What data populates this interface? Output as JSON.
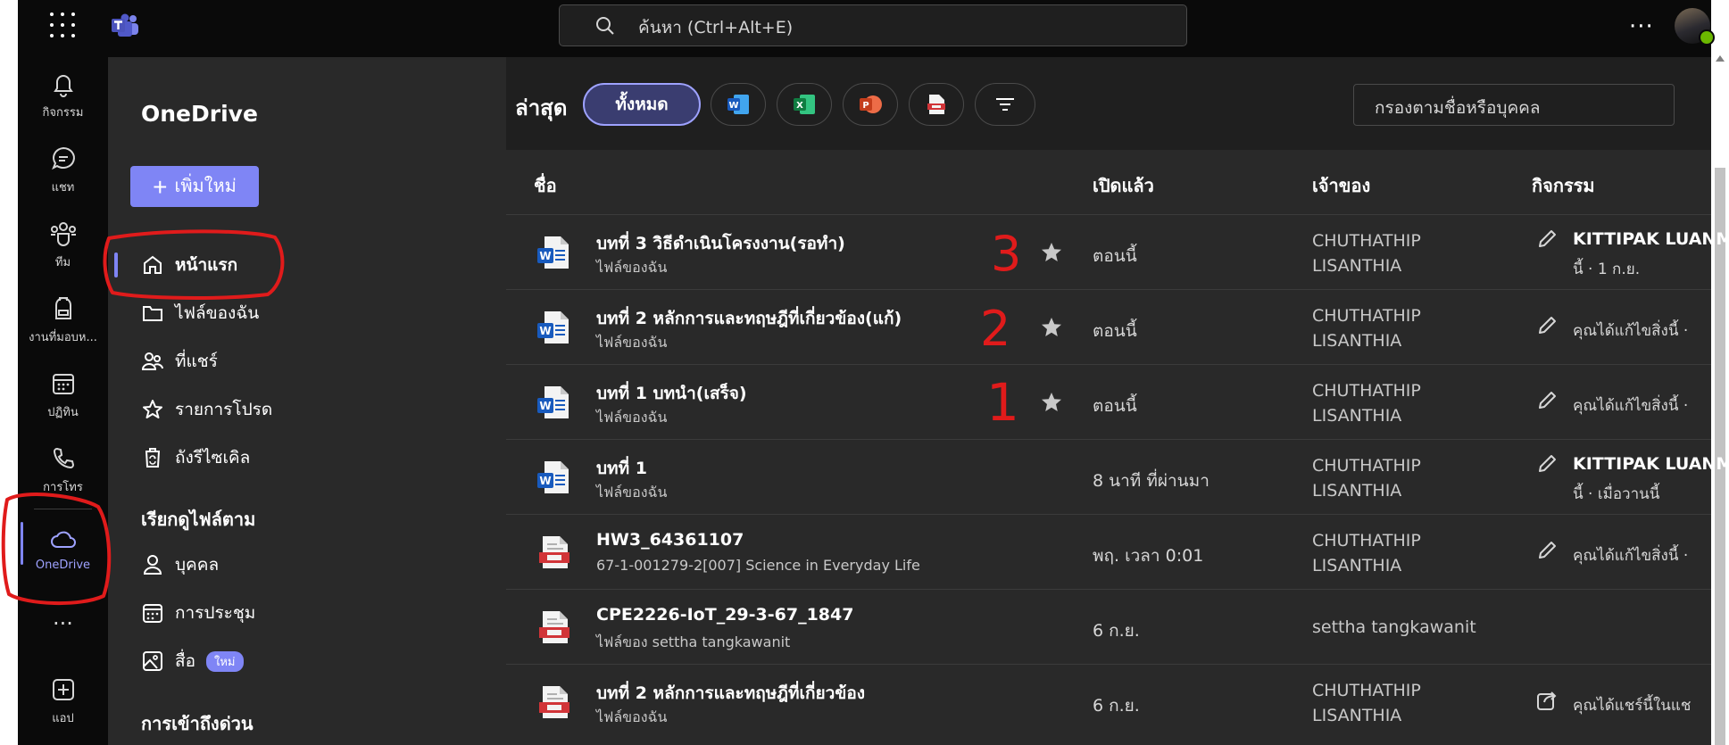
{
  "search": {
    "placeholder": "ค้นหา (Ctrl+Alt+E)"
  },
  "rail": {
    "items": [
      {
        "label": "กิจกรรม"
      },
      {
        "label": "แชท"
      },
      {
        "label": "ทีม"
      },
      {
        "label": "งานที่มอบห..."
      },
      {
        "label": "ปฏิทิน"
      },
      {
        "label": "การโทร"
      },
      {
        "label": "OneDrive"
      },
      {
        "label": "แอป"
      }
    ]
  },
  "nav": {
    "title": "OneDrive",
    "add_new": "เพิ่มใหม่",
    "items": [
      {
        "label": "หน้าแรก"
      },
      {
        "label": "ไฟล์ของฉัน"
      },
      {
        "label": "ที่แชร์"
      },
      {
        "label": "รายการโปรด"
      },
      {
        "label": "ถังรีไซเคิล"
      }
    ],
    "browse_title": "เรียกดูไฟล์ตาม",
    "browse_items": [
      {
        "label": "บุคคล"
      },
      {
        "label": "การประชุม"
      },
      {
        "label": "สื่อ",
        "badge": "ใหม่"
      }
    ],
    "quick_access_title": "การเข้าถึงด่วน"
  },
  "filters": {
    "recent_label": "ล่าสุด",
    "all_label": "ทั้งหมด",
    "filter_placeholder": "กรองตามชื่อหรือบุคคล"
  },
  "table": {
    "headers": {
      "name": "ชื่อ",
      "opened": "เปิดแล้ว",
      "owner": "เจ้าของ",
      "activity": "กิจกรรม"
    },
    "rows": [
      {
        "name": "บทที่ 3 วิธีดำเนินโครงงาน(รอทำ)",
        "location": "ไฟล์ของฉัน",
        "opened": "ตอนนี้",
        "owner_line1": "CHUTHATHIP",
        "owner_line2": "LISANTHIA",
        "activity_name": "KITTIPAK LUANM",
        "activity_sub": "นี้ · 1 ก.ย.",
        "type": "word",
        "favorite": true
      },
      {
        "name": "บทที่ 2 หลักการและทฤษฎีที่เกี่ยวข้อง(แก้)",
        "location": "ไฟล์ของฉัน",
        "opened": "ตอนนี้",
        "owner_line1": "CHUTHATHIP",
        "owner_line2": "LISANTHIA",
        "activity_text": "คุณได้แก้ไขสิ่งนี้ ·",
        "type": "word",
        "favorite": true
      },
      {
        "name": "บทที่ 1 บทนำ(เสร็จ)",
        "location": "ไฟล์ของฉัน",
        "opened": "ตอนนี้",
        "owner_line1": "CHUTHATHIP",
        "owner_line2": "LISANTHIA",
        "activity_text": "คุณได้แก้ไขสิ่งนี้ ·",
        "type": "word",
        "favorite": true
      },
      {
        "name": "บทที่ 1",
        "location": "ไฟล์ของฉัน",
        "opened": "8 นาที ที่ผ่านมา",
        "owner_line1": "CHUTHATHIP",
        "owner_line2": "LISANTHIA",
        "activity_name": "KITTIPAK LUANM",
        "activity_sub": "นี้ · เมื่อวานนี้",
        "type": "word",
        "favorite": false
      },
      {
        "name": "HW3_64361107",
        "location": "67-1-001279-2[007] Science in Everyday Life",
        "opened": "พฤ. เวลา 0:01",
        "owner_line1": "CHUTHATHIP",
        "owner_line2": "LISANTHIA",
        "activity_text": "คุณได้แก้ไขสิ่งนี้ ·",
        "type": "pdf",
        "favorite": false
      },
      {
        "name": "CPE2226-IoT_29-3-67_1847",
        "location": "ไฟล์ของ settha tangkawanit",
        "opened": "6 ก.ย.",
        "owner_single": "settha tangkawanit",
        "type": "pdf",
        "favorite": false
      },
      {
        "name": "บทที่ 2 หลักการและทฤษฎีที่เกี่ยวข้อง",
        "location": "ไฟล์ของฉัน",
        "opened": "6 ก.ย.",
        "owner_line1": "CHUTHATHIP",
        "owner_line2": "LISANTHIA",
        "activity_text": "คุณได้แชร์นี้ในแช",
        "type": "pdf",
        "favorite": false
      }
    ]
  },
  "annotations": {
    "numbers": [
      "3",
      "2",
      "1"
    ]
  },
  "colors": {
    "accent": "#7f85f5",
    "annotation": "#e01b1b",
    "word": "#185abd",
    "pdf": "#d13438"
  }
}
